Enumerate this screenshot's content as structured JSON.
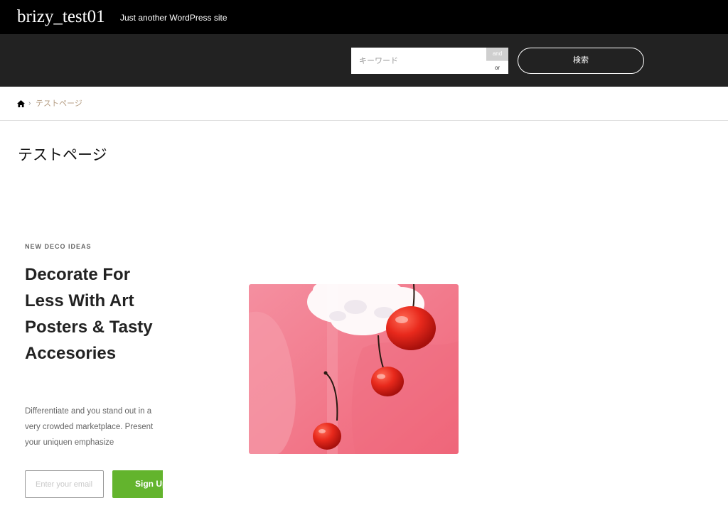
{
  "site": {
    "title": "brizy_test01",
    "tagline": "Just another WordPress site"
  },
  "search": {
    "placeholder": "キーワード",
    "mode_and": "and",
    "mode_or": "or",
    "button_label": "検索"
  },
  "breadcrumb": {
    "home_icon": "home-icon",
    "separator": "›",
    "current": "テストページ"
  },
  "page": {
    "title": "テストページ"
  },
  "hero": {
    "eyebrow": "NEW DECO IDEAS",
    "headline": "Decorate For Less With Art Posters & Tasty Accesories",
    "body": "Differentiate and you stand out in a very crowded marketplace. Present your uniquen emphasize",
    "email_placeholder": "Enter your email",
    "signup_label": "Sign Up",
    "signup_color": "#63b42d",
    "image_subject": "red-cherries-on-pink-background"
  },
  "colors": {
    "topbar": "#000000",
    "searchbar": "#222222",
    "breadcrumb_current": "#b69e84"
  }
}
